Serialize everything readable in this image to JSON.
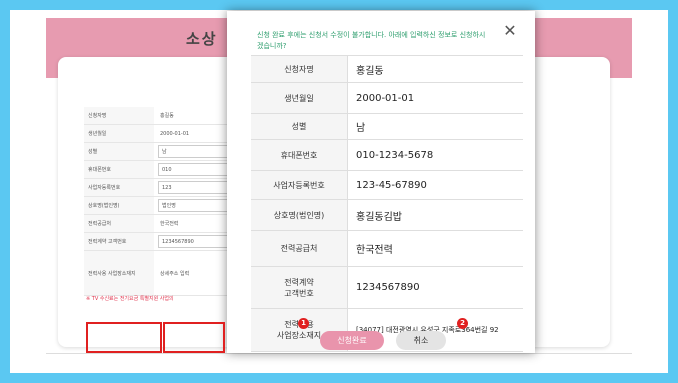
{
  "background": {
    "title": "소상",
    "form_rows": [
      {
        "label": "신청자명",
        "value": "홍길동",
        "style": "plain"
      },
      {
        "label": "생년월일",
        "value": "2000-01-01",
        "style": "plain"
      },
      {
        "label": "성별",
        "value": "남",
        "style": "box"
      },
      {
        "label": "휴대폰번호",
        "value": "010",
        "style": "box"
      },
      {
        "label": "사업자등록번호",
        "value": "123",
        "style": "box"
      },
      {
        "label": "상호명(법인명)",
        "value": "법인명",
        "style": "box"
      },
      {
        "label": "전력공급처",
        "value": "한국전력",
        "style": "plain"
      },
      {
        "label": "전력계약 고객번호",
        "value": "1234567890",
        "style": "box"
      },
      {
        "label": "전력사용 사업장소재지",
        "value": "상세주소 입력",
        "style": "tall"
      }
    ],
    "note": "※ TV 수신료는 전기요금 특별지원 사업의"
  },
  "dialog": {
    "notice": "신청 완료 후에는 신청서 수정이 불가합니다. 아래에 입력하신 정보로 신청하시겠습니까?",
    "close_label": "✕",
    "rows": [
      {
        "label": "신청자명",
        "value": "홍길동"
      },
      {
        "label": "생년월일",
        "value": "2000-01-01"
      },
      {
        "label": "성별",
        "value": "남"
      },
      {
        "label": "휴대폰번호",
        "value": "010-1234-5678"
      },
      {
        "label": "사업자등록번호",
        "value": "123-45-67890"
      },
      {
        "label": "상호명(법인명)",
        "value": "홍길동김밥"
      },
      {
        "label": "전력공급처",
        "value": "한국전력"
      },
      {
        "label": "전력계약\n고객번호",
        "value": "1234567890"
      },
      {
        "label": "전력사용\n사업장소재지",
        "value": "[34077] 대전광역시 유성구 지족로364번길 92"
      }
    ],
    "apply_label": "신청완료",
    "cancel_label": "취소",
    "badge1": "1",
    "badge2": "2"
  }
}
